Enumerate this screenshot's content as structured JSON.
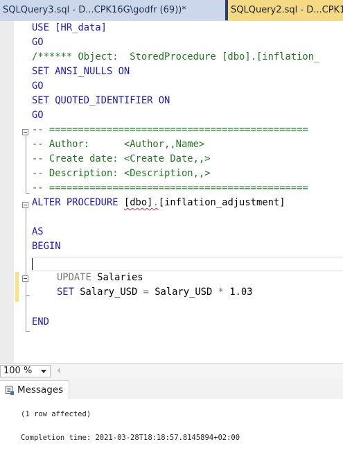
{
  "tabs": [
    {
      "label": "SQLQuery3.sql - D...CPK16G\\godfr (69))*",
      "active": false
    },
    {
      "label": "SQLQuery2.sql - D...CPK1",
      "active": true
    }
  ],
  "editor": {
    "lines": {
      "l1": "USE [HR_data]",
      "l2": "GO",
      "l3": "/****** Object:  StoredProcedure [dbo].[inflation_",
      "l4a": "SET ANSI_NULLS ",
      "l4b": "ON",
      "l5": "GO",
      "l6a": "SET QUOTED_IDENTIFIER ",
      "l6b": "ON",
      "l7": "GO",
      "l8": "-- =============================================",
      "l9": "-- Author:      <Author,,Name>",
      "l10": "-- Create date: <Create Date,,>",
      "l11": "-- Description: <Description,,>",
      "l12": "-- =============================================",
      "l13a": "ALTER PROCEDURE ",
      "l13b": "[dbo]",
      "l13c": ".",
      "l13d": "[inflation_adjustment]",
      "l14": "AS",
      "l15": "BEGIN",
      "l16a": "UPDATE ",
      "l16b": "Salaries",
      "l17a": "SET ",
      "l17b": "Salary_USD ",
      "l17c": "= ",
      "l17d": "Salary_USD ",
      "l17e": "* ",
      "l17f": "1.03",
      "l18": "END"
    }
  },
  "status": {
    "zoom": "100 %"
  },
  "results": {
    "tab_label": "Messages",
    "messages": [
      "(1 row affected)",
      "Completion time: 2021-03-28T18:18:57.8145894+02:00"
    ]
  },
  "colors": {
    "keyword": "#1a1acc",
    "comment": "#1f7a1f",
    "operator": "#777777",
    "active_tab": "#f4da82",
    "inactive_tab": "#cdd7eb"
  }
}
